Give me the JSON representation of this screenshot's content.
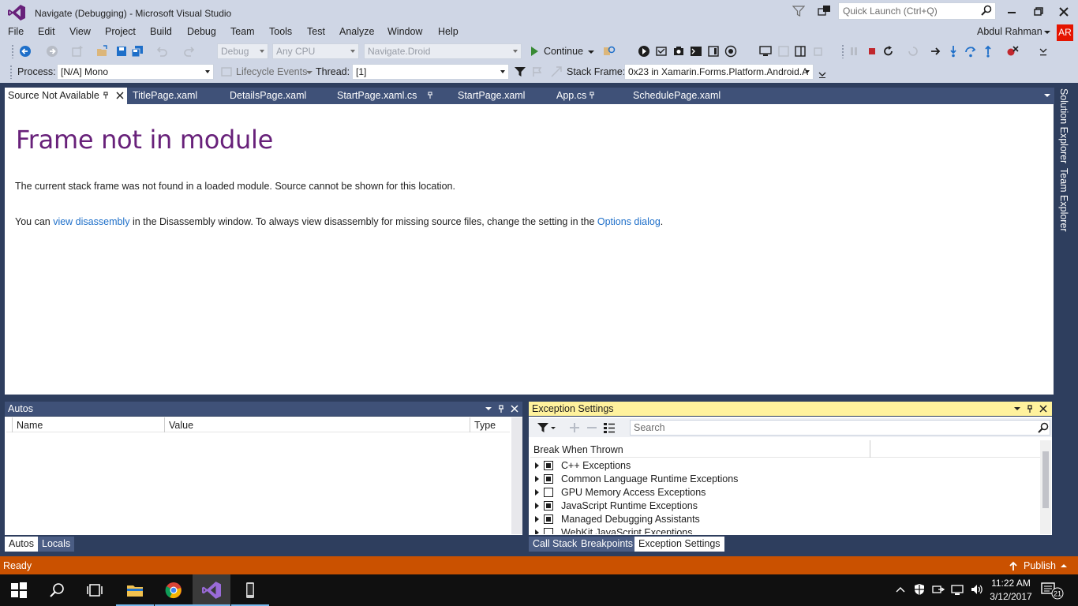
{
  "window": {
    "title": "Navigate (Debugging) - Microsoft Visual Studio",
    "quick_launch_placeholder": "Quick Launch (Ctrl+Q)"
  },
  "menu": [
    "File",
    "Edit",
    "View",
    "Project",
    "Build",
    "Debug",
    "Team",
    "Tools",
    "Test",
    "Analyze",
    "Window",
    "Help"
  ],
  "user": {
    "name": "Abdul Rahman",
    "initials": "AR",
    "avatar_color": "#e51400"
  },
  "toolbar1": {
    "config": "Debug",
    "platform": "Any CPU",
    "startup_project": "Navigate.Droid",
    "continue_label": "Continue"
  },
  "toolbar2": {
    "process_label": "Process:",
    "process_value": "[N/A] Mono",
    "lifecycle_label": "Lifecycle Events",
    "thread_label": "Thread:",
    "thread_value": "[1]",
    "stack_frame_label": "Stack Frame:",
    "stack_frame_value": "0x23 in Xamarin.Forms.Platform.Android.A"
  },
  "doc_tabs": [
    {
      "label": "Source Not Available",
      "active": true
    },
    {
      "label": "TitlePage.xaml"
    },
    {
      "label": "DetailsPage.xaml"
    },
    {
      "label": "StartPage.xaml.cs"
    },
    {
      "label": "StartPage.xaml"
    },
    {
      "label": "App.cs"
    },
    {
      "label": "SchedulePage.xaml"
    }
  ],
  "document": {
    "heading": "Frame not in module",
    "line1": "The current stack frame was not found in a loaded module. Source cannot be shown for this location.",
    "line2_pre": "You can ",
    "line2_link1": "view disassembly",
    "line2_mid": " in the Disassembly window. To always view disassembly for missing source files, change the setting in the ",
    "line2_link2": "Options dialog",
    "line2_post": "."
  },
  "side_tabs": [
    "Solution Explorer",
    "Team Explorer"
  ],
  "autos": {
    "title": "Autos",
    "columns": [
      "Name",
      "Value",
      "Type"
    ],
    "tabs": [
      "Autos",
      "Locals"
    ]
  },
  "exceptions": {
    "title": "Exception Settings",
    "search_placeholder": "Search",
    "column": "Break When Thrown",
    "rows": [
      {
        "label": "C++ Exceptions",
        "checked": true
      },
      {
        "label": "Common Language Runtime Exceptions",
        "checked": true
      },
      {
        "label": "GPU Memory Access Exceptions",
        "checked": false
      },
      {
        "label": "JavaScript Runtime Exceptions",
        "checked": true
      },
      {
        "label": "Managed Debugging Assistants",
        "checked": true
      },
      {
        "label": "WebKit JavaScript Exceptions",
        "checked": false
      }
    ],
    "tabs": [
      "Call Stack",
      "Breakpoints",
      "Exception Settings"
    ]
  },
  "status": {
    "text": "Ready",
    "publish": "Publish",
    "bar_color": "#ca5100"
  },
  "taskbar": {
    "time": "11:22 AM",
    "date": "3/12/2017",
    "notifications": "21"
  }
}
